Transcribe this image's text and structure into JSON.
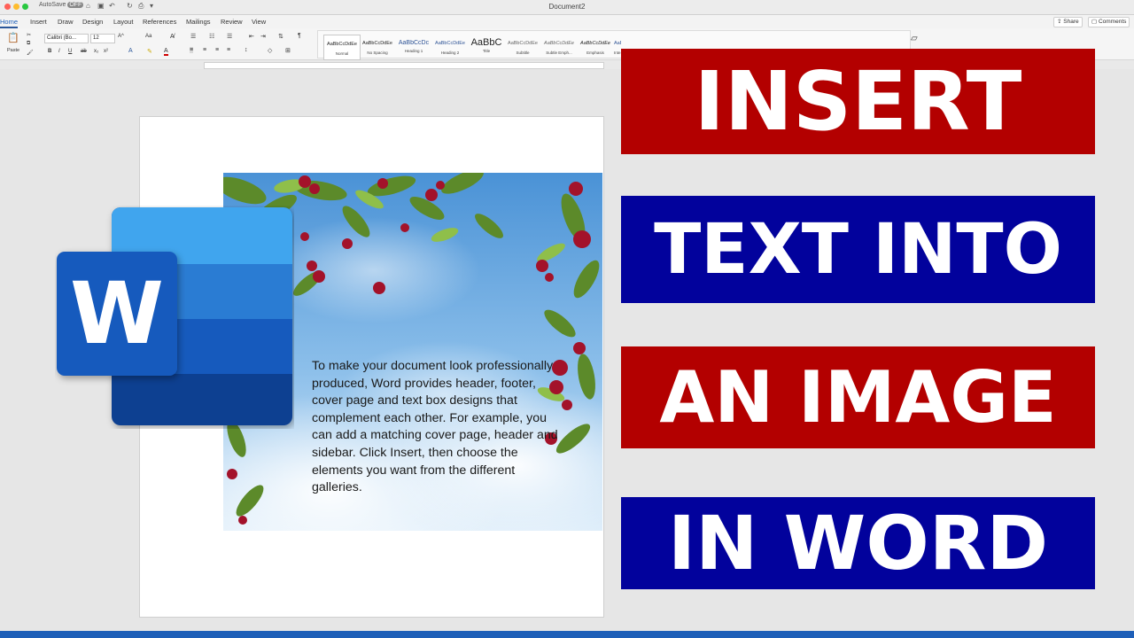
{
  "titlebar": {
    "autosave": "AutoSave",
    "autosave_state": "OFF",
    "title": "Document2"
  },
  "tabs": [
    "Home",
    "Insert",
    "Draw",
    "Design",
    "Layout",
    "References",
    "Mailings",
    "Review",
    "View"
  ],
  "share_label": "Share",
  "comments_label": "Comments",
  "ribbon": {
    "paste_label": "Paste",
    "font_name": "Calibri (Bo...",
    "font_size": "12",
    "text_effects_label": "Text Effe...",
    "styles": [
      {
        "sample": "AaBbCcDdEe",
        "name": "Normal"
      },
      {
        "sample": "AaBbCcDdEe",
        "name": "No Spacing"
      },
      {
        "sample": "AaBbCcDc",
        "name": "Heading 1"
      },
      {
        "sample": "AaBbCcDdEe",
        "name": "Heading 2"
      },
      {
        "sample": "AaBbC",
        "name": "Title"
      },
      {
        "sample": "AaBbCcDdEe",
        "name": "Subtitle"
      },
      {
        "sample": "AaBbCcDdEe",
        "name": "Subtle Emph..."
      },
      {
        "sample": "AaBbCcDdEe",
        "name": "Emphasis"
      },
      {
        "sample": "AaBbCcDdEe",
        "name": "Inte..."
      }
    ]
  },
  "document": {
    "body_text": "To make your document look professionally produced, Word provides header, footer, cover page and text box designs that complement each other. For example, you can add a matching cover page, header and sidebar. Click Insert, then choose the elements you want from the different galleries."
  },
  "logo": {
    "letter": "W"
  },
  "banners": [
    "INSERT",
    "TEXT INTO",
    "AN IMAGE",
    "IN WORD"
  ],
  "colors": {
    "banner_red": "#b30000",
    "banner_blue": "#02029c",
    "word_blue": "#2b579a",
    "frame_blue": "#1e5fb8"
  }
}
